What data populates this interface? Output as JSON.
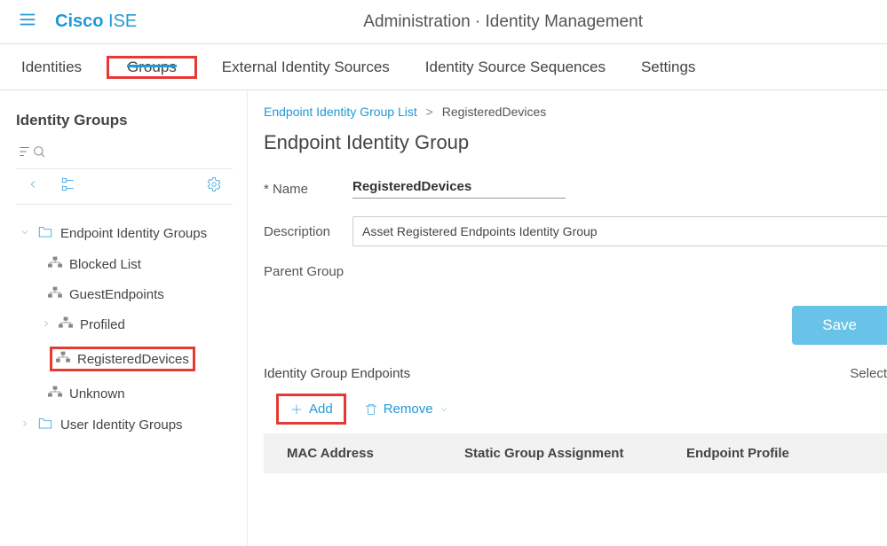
{
  "brand_bold": "Cisco",
  "brand_light": " ISE",
  "page_title": "Administration · Identity Management",
  "tabs": {
    "identities": "Identities",
    "groups": "Groups",
    "external": "External Identity Sources",
    "seq": "Identity Source Sequences",
    "settings": "Settings"
  },
  "sidebar": {
    "title": "Identity Groups",
    "root": "Endpoint Identity Groups",
    "blocked": "Blocked List",
    "guest": "GuestEndpoints",
    "profiled": "Profiled",
    "registered": "RegisteredDevices",
    "unknown": "Unknown",
    "user": "User Identity Groups"
  },
  "crumbs": {
    "list": "Endpoint Identity Group List",
    "current": "RegisteredDevices"
  },
  "main_title": "Endpoint Identity Group",
  "form": {
    "name_label": "* Name",
    "name_value": "RegisteredDevices",
    "desc_label": "Description",
    "desc_value": "Asset Registered Endpoints Identity Group",
    "parent_label": "Parent Group"
  },
  "save": "Save",
  "ige_title": "Identity Group Endpoints",
  "select": "Select",
  "add": "Add",
  "remove": "Remove",
  "cols": {
    "mac": "MAC Address",
    "sga": "Static Group Assignment",
    "ep": "Endpoint Profile"
  }
}
